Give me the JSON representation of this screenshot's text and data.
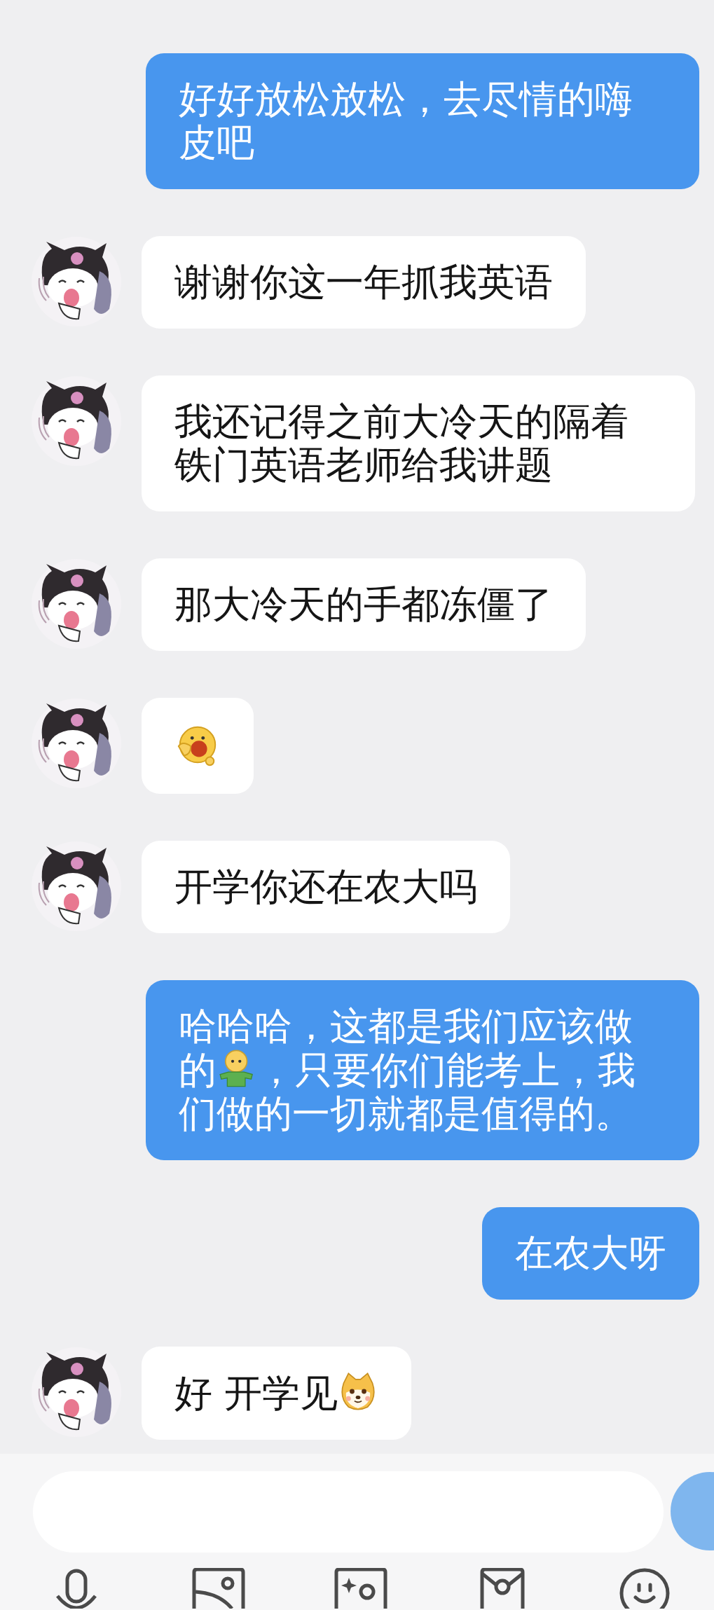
{
  "messages": [
    {
      "outgoing": true,
      "parts": [
        {
          "kind": "text",
          "text": "好好放松放松，去尽情的嗨皮吧"
        }
      ]
    },
    {
      "outgoing": false,
      "parts": [
        {
          "kind": "text",
          "text": "谢谢你这一年抓我英语"
        }
      ]
    },
    {
      "outgoing": false,
      "parts": [
        {
          "kind": "text",
          "text": "我还记得之前大冷天的隔着铁门英语老师给我讲题"
        }
      ]
    },
    {
      "outgoing": false,
      "parts": [
        {
          "kind": "text",
          "text": "那大冷天的手都冻僵了"
        }
      ]
    },
    {
      "outgoing": false,
      "parts": [
        {
          "kind": "laugh"
        }
      ]
    },
    {
      "outgoing": false,
      "parts": [
        {
          "kind": "text",
          "text": "开学你还在农大吗"
        }
      ]
    },
    {
      "outgoing": true,
      "parts": [
        {
          "kind": "text",
          "text": "哈哈哈，这都是我们应该做的"
        },
        {
          "kind": "shrug"
        },
        {
          "kind": "text",
          "text": "，只要你们能考上，我们做的一切就都是值得的。"
        }
      ]
    },
    {
      "outgoing": true,
      "parts": [
        {
          "kind": "text",
          "text": "在农大呀"
        }
      ]
    },
    {
      "outgoing": false,
      "parts": [
        {
          "kind": "text",
          "text": "好 开学见"
        },
        {
          "kind": "shiba"
        }
      ]
    }
  ]
}
